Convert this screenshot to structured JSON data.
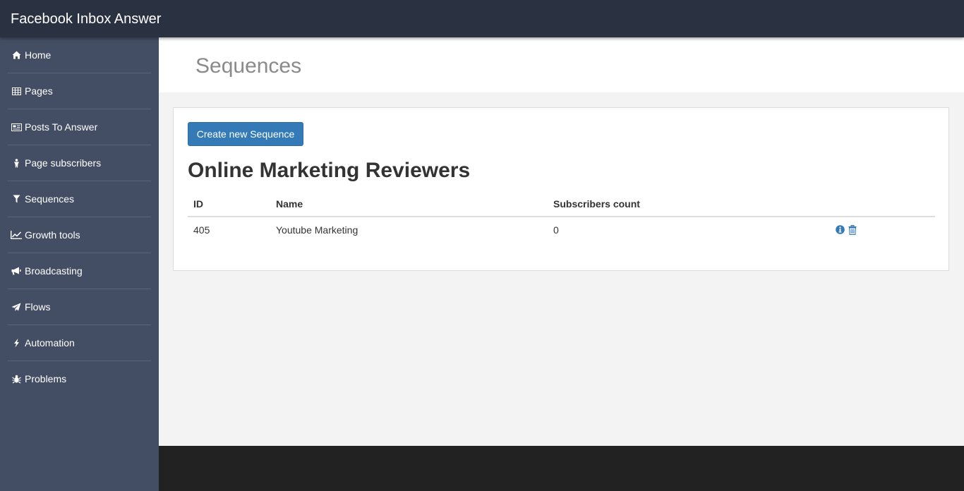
{
  "app": {
    "title": "Facebook Inbox Answer"
  },
  "sidebar": {
    "items": [
      {
        "label": "Home",
        "icon": "home-icon"
      },
      {
        "label": "Pages",
        "icon": "table-icon"
      },
      {
        "label": "Posts To Answer",
        "icon": "newspaper-icon"
      },
      {
        "label": "Page subscribers",
        "icon": "person-icon"
      },
      {
        "label": "Sequences",
        "icon": "filter-icon"
      },
      {
        "label": "Growth tools",
        "icon": "line-chart-icon"
      },
      {
        "label": "Broadcasting",
        "icon": "bullhorn-icon"
      },
      {
        "label": "Flows",
        "icon": "paper-plane-icon"
      },
      {
        "label": "Automation",
        "icon": "bolt-icon"
      },
      {
        "label": "Problems",
        "icon": "bug-icon"
      }
    ]
  },
  "page": {
    "title": "Sequences",
    "create_button": "Create new Sequence",
    "list_title": "Online Marketing Reviewers"
  },
  "table": {
    "headers": [
      "ID",
      "Name",
      "Subscribers count",
      ""
    ],
    "rows": [
      {
        "id": "405",
        "name": "Youtube Marketing",
        "count": "0"
      }
    ]
  },
  "colors": {
    "topbar": "#2a3141",
    "sidebar": "#434e64",
    "primary": "#337ab7",
    "footer": "#222222"
  }
}
